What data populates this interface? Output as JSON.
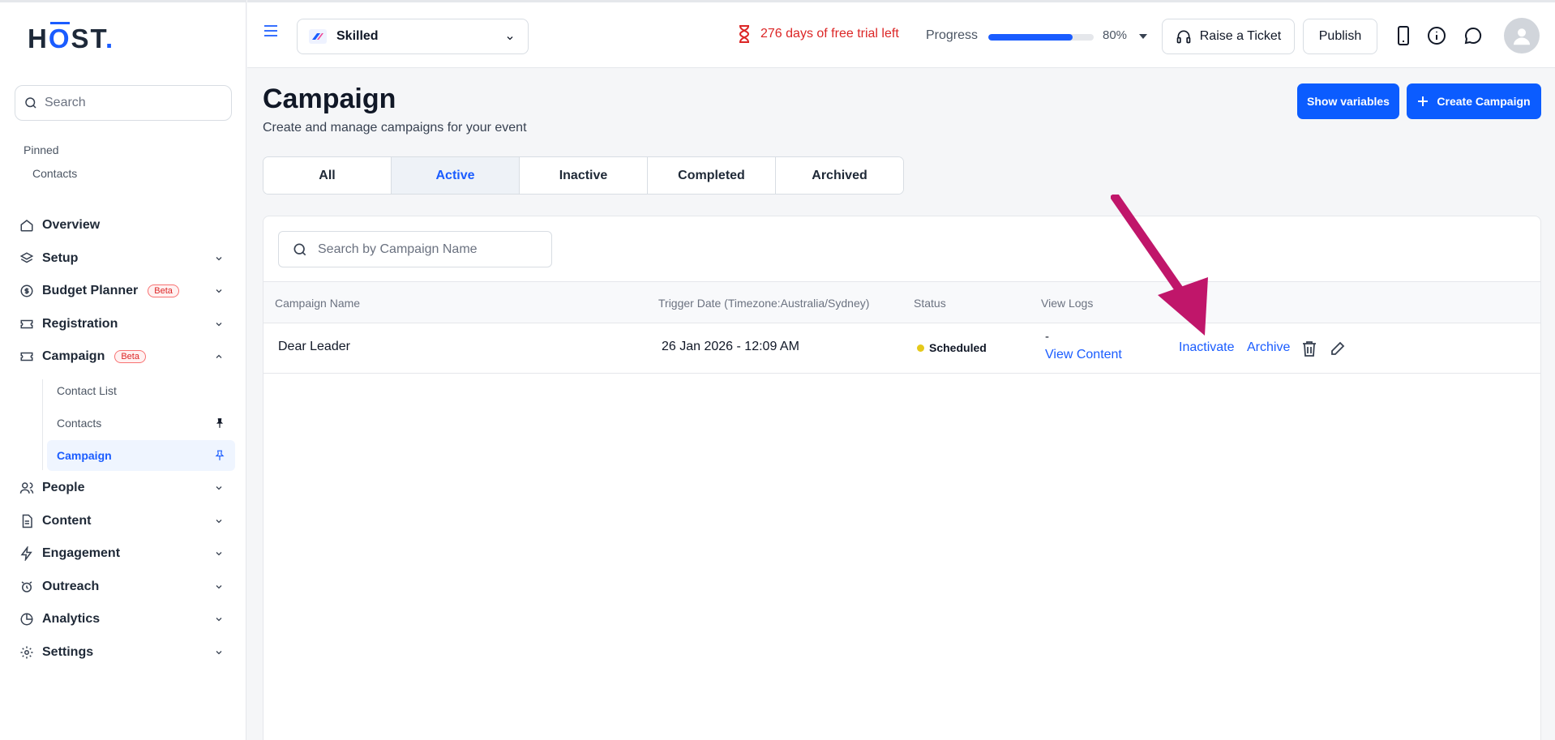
{
  "sidebar": {
    "logo_prefix": "H",
    "logo_o": "O",
    "logo_suffix": "ST",
    "logo_dot": ".",
    "search_placeholder": "Search",
    "pinned_label": "Pinned",
    "pinned_items": [
      "Contacts"
    ],
    "nav": {
      "overview": "Overview",
      "setup": "Setup",
      "budget": "Budget Planner",
      "registration": "Registration",
      "campaign": "Campaign",
      "people": "People",
      "content": "Content",
      "engagement": "Engagement",
      "outreach": "Outreach",
      "analytics": "Analytics",
      "settings": "Settings"
    },
    "beta_label": "Beta",
    "campaign_sub": [
      "Contact List",
      "Contacts",
      "Campaign"
    ]
  },
  "topbar": {
    "event_name": "Skilled",
    "trial_text": "276 days of free trial left",
    "progress_label": "Progress",
    "progress_value": 80,
    "progress_text": "80%",
    "ticket_label": "Raise a Ticket",
    "publish_label": "Publish"
  },
  "main": {
    "title": "Campaign",
    "subtitle": "Create and manage campaigns for your event",
    "show_variables": "Show variables",
    "create_campaign": "Create Campaign",
    "tabs": [
      "All",
      "Active",
      "Inactive",
      "Completed",
      "Archived"
    ],
    "active_tab": "Active",
    "search_placeholder": "Search by Campaign Name",
    "columns": [
      "Campaign Name",
      "Trigger Date (Timezone:Australia/Sydney)",
      "Status",
      "View Logs"
    ],
    "rows": [
      {
        "name": "Dear Leader",
        "trigger_date": "26 Jan 2026 - 12:09 AM",
        "status": "Scheduled",
        "logs": "-",
        "view_content": "View Content",
        "inactivate": "Inactivate",
        "archive": "Archive"
      }
    ]
  },
  "colors": {
    "accent": "#1a5cff",
    "trial": "#dc2626",
    "annotation_arrow": "#c0166a",
    "status_scheduled": "#e5c91a"
  }
}
